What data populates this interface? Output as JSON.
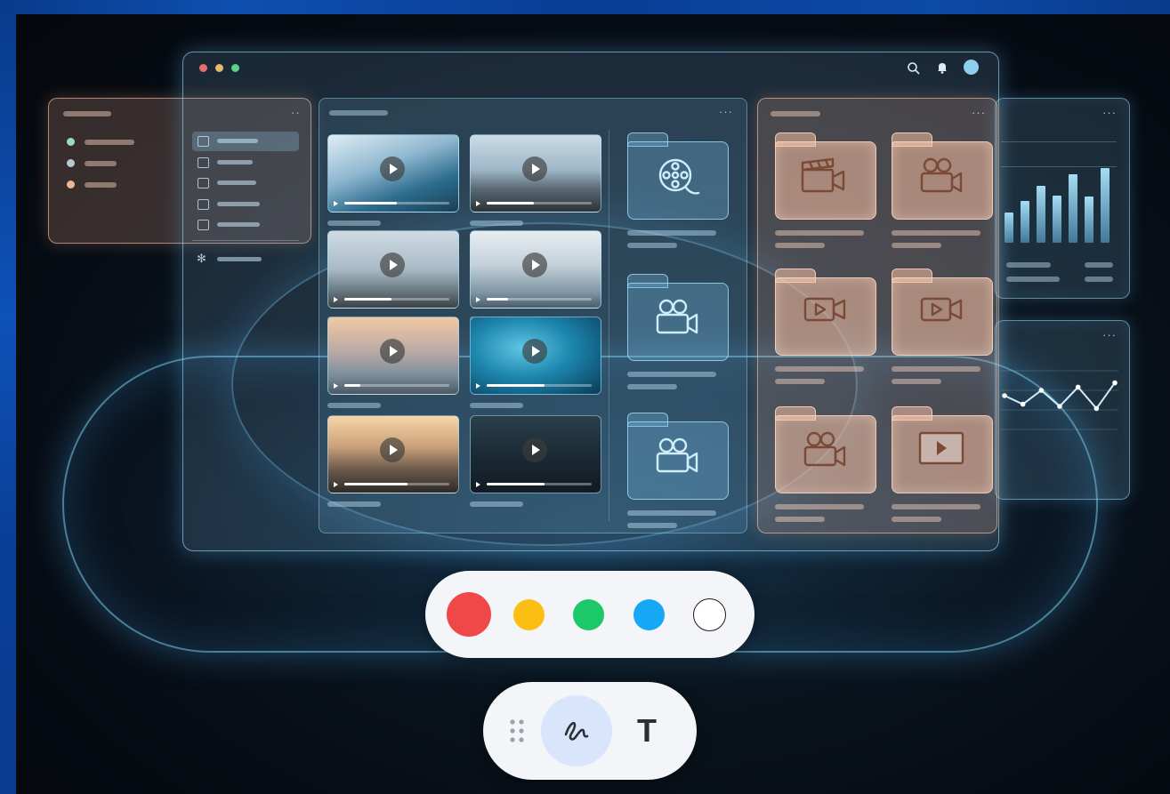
{
  "colors": {
    "background": "#060a12",
    "traffic_red": "#e46f6a",
    "traffic_yellow": "#e8b96a",
    "traffic_green": "#5fd08a",
    "glass_blue": "#8ecfee",
    "glass_orange": "#f3c1a4",
    "pen_red": "#f04848",
    "pen_yellow": "#fcbe12",
    "pen_green": "#1cc86a",
    "pen_blue": "#16a8f4",
    "pen_white": "#ffffff"
  },
  "window": {
    "header_icons": [
      "search-icon",
      "bell-icon",
      "avatar"
    ]
  },
  "sidebar": {
    "items": [
      {
        "icon": "folder-icon",
        "active": true
      },
      {
        "icon": "folder-icon",
        "active": false
      },
      {
        "icon": "folder-icon",
        "active": false
      },
      {
        "icon": "folder-icon",
        "active": false
      },
      {
        "icon": "folder-icon",
        "active": false
      }
    ],
    "settings_icon": "gear-icon"
  },
  "videos": [
    {
      "scene": "surfer on wave",
      "progress": 0.5
    },
    {
      "scene": "people on beach",
      "progress": 0.45
    },
    {
      "scene": "person sitting on beach",
      "progress": 0.45
    },
    {
      "scene": "drone over snow",
      "progress": 0.2
    },
    {
      "scene": "sunset beach walk",
      "progress": 0.15
    },
    {
      "scene": "underwater swimmer",
      "progress": 0.55
    },
    {
      "scene": "cyclist at sunset",
      "progress": 0.6
    },
    {
      "scene": "video editing room",
      "progress": 0.55
    }
  ],
  "blue_folders": [
    "film-reel-icon",
    "video-camera-icon",
    "video-camera-icon"
  ],
  "orange_folders": [
    "clapperboard-icon",
    "video-camera-icon",
    "video-play-icon",
    "video-play-icon",
    "video-camera-icon",
    "play-screen-icon"
  ],
  "chart_data": [
    {
      "type": "bar",
      "values": [
        40,
        55,
        75,
        62,
        90,
        60,
        98
      ]
    },
    {
      "type": "line",
      "values": [
        30,
        22,
        35,
        20,
        38,
        18,
        42
      ]
    }
  ],
  "toolbar": {
    "swatches": [
      "red",
      "yellow",
      "green",
      "blue",
      "white"
    ],
    "selected_swatch": "red",
    "tools": [
      "drag-handle-icon",
      "pen-icon",
      "text-icon"
    ],
    "selected_tool": "pen-icon",
    "text_tool_label": "T"
  }
}
